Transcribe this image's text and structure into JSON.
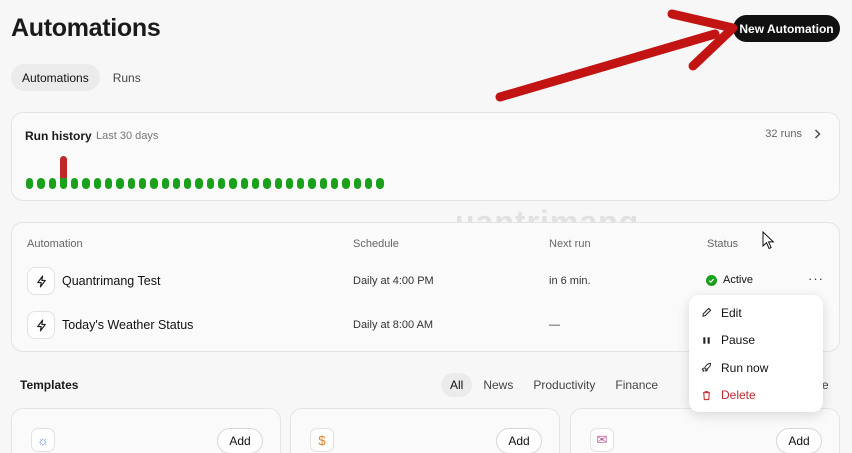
{
  "header": {
    "title": "Automations",
    "new_button": "New Automation"
  },
  "tabs": [
    {
      "label": "Automations",
      "active": true
    },
    {
      "label": "Runs",
      "active": false
    }
  ],
  "run_history": {
    "title": "Run history",
    "subtitle": "Last 30 days",
    "runs_label": "32 runs",
    "days": [
      "ok",
      "ok",
      "ok",
      "err",
      "ok",
      "ok",
      "ok",
      "ok",
      "ok",
      "ok",
      "ok",
      "ok",
      "ok",
      "ok",
      "ok",
      "ok",
      "ok",
      "ok",
      "ok",
      "ok",
      "ok",
      "ok",
      "ok",
      "ok",
      "ok",
      "ok",
      "ok",
      "ok",
      "ok",
      "ok",
      "ok",
      "ok"
    ],
    "colors": {
      "ok": "#1ba01b",
      "err": "#c1272d"
    }
  },
  "table": {
    "columns": {
      "automation": "Automation",
      "schedule": "Schedule",
      "next_run": "Next run",
      "status": "Status"
    },
    "rows": [
      {
        "name": "Quantrimang Test",
        "schedule": "Daily at 4:00 PM",
        "next_run": "in 6 min.",
        "status": "Active",
        "icon": "bolt-icon"
      },
      {
        "name": "Today's Weather Status",
        "schedule": "Daily at 8:00 AM",
        "next_run": "—",
        "status": "",
        "icon": "bolt-icon"
      }
    ],
    "more_label": "···"
  },
  "context_menu": {
    "items": [
      {
        "label": "Edit",
        "icon": "pencil-icon"
      },
      {
        "label": "Pause",
        "icon": "pause-icon"
      },
      {
        "label": "Run now",
        "icon": "rocket-icon"
      },
      {
        "label": "Delete",
        "icon": "trash-icon",
        "danger": true
      }
    ]
  },
  "templates": {
    "title": "Templates",
    "filters": [
      {
        "label": "All",
        "active": true
      },
      {
        "label": "News"
      },
      {
        "label": "Productivity"
      },
      {
        "label": "Finance"
      }
    ],
    "filter_cut": "e",
    "cards": [
      {
        "icon": "sun-icon",
        "glyph": "☼",
        "add": "Add",
        "color": "#5a8ad6"
      },
      {
        "icon": "dollar-icon",
        "glyph": "$",
        "add": "Add",
        "color": "#d9822b"
      },
      {
        "icon": "mail-icon",
        "glyph": "✉",
        "add": "Add",
        "color": "#c0569a"
      }
    ]
  },
  "watermark": "uantrimang"
}
